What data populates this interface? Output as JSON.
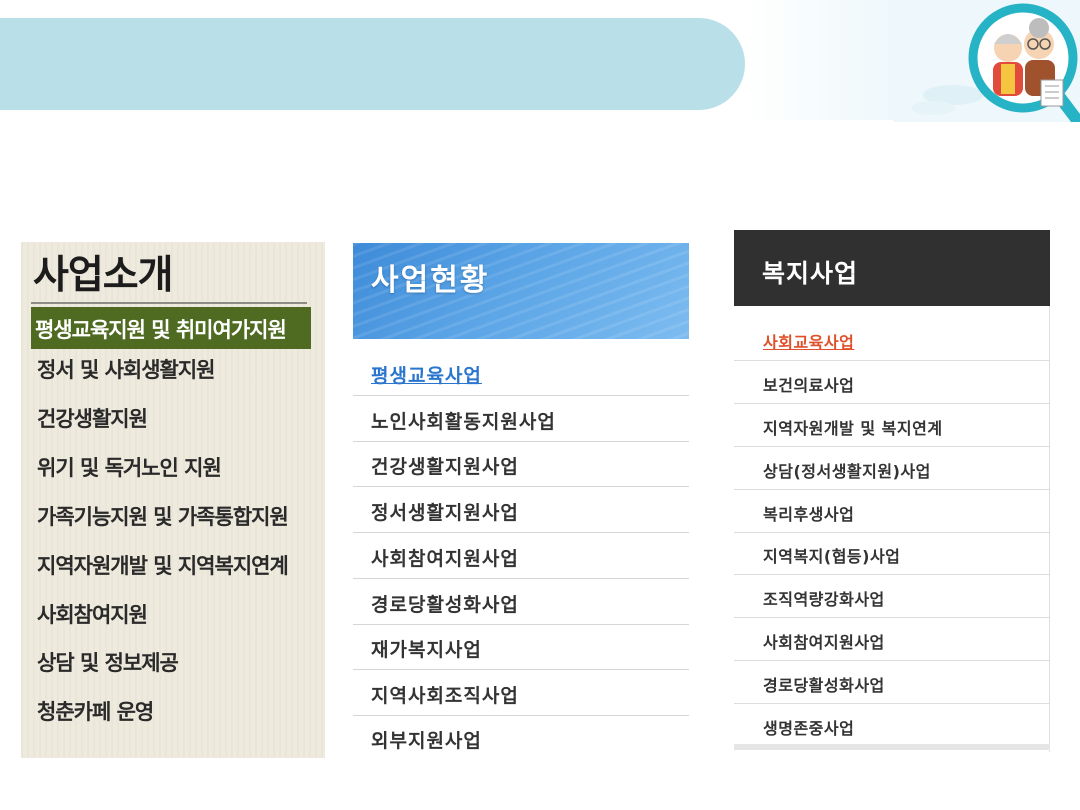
{
  "panel1": {
    "title": "사업소개",
    "active": "평생교육지원 및 취미여가지원",
    "items": [
      "정서 및 사회생활지원",
      "건강생활지원",
      "위기 및 독거노인 지원",
      "가족기능지원 및 가족통합지원",
      "지역자원개발 및 지역복지연계",
      "사회참여지원",
      "상담 및 정보제공",
      "청춘카페 운영"
    ]
  },
  "panel2": {
    "title": "사업현황",
    "items": [
      "평생교육사업",
      "노인사회활동지원사업",
      "건강생활지원사업",
      "정서생활지원사업",
      "사회참여지원사업",
      "경로당활성화사업",
      "재가복지사업",
      "지역사회조직사업",
      "외부지원사업"
    ]
  },
  "panel3": {
    "title": "복지사업",
    "items": [
      "사회교육사업",
      "보건의료사업",
      "지역자원개발 및 복지연계",
      "상담(정서생활지원)사업",
      "복리후생사업",
      "지역복지(협등)사업",
      "조직역량강화사업",
      "사회참여지원사업",
      "경로당활성화사업",
      "생명존중사업"
    ]
  },
  "colors": {
    "banner": "#b9dfe8",
    "panel1_active": "#4f6b22",
    "panel2_header": "#4a97de",
    "panel2_active_text": "#2a76cf",
    "panel3_header": "#303030",
    "panel3_active_text": "#e0502a"
  },
  "icons": {
    "corner": "magnifier-elderly-couple-icon"
  }
}
